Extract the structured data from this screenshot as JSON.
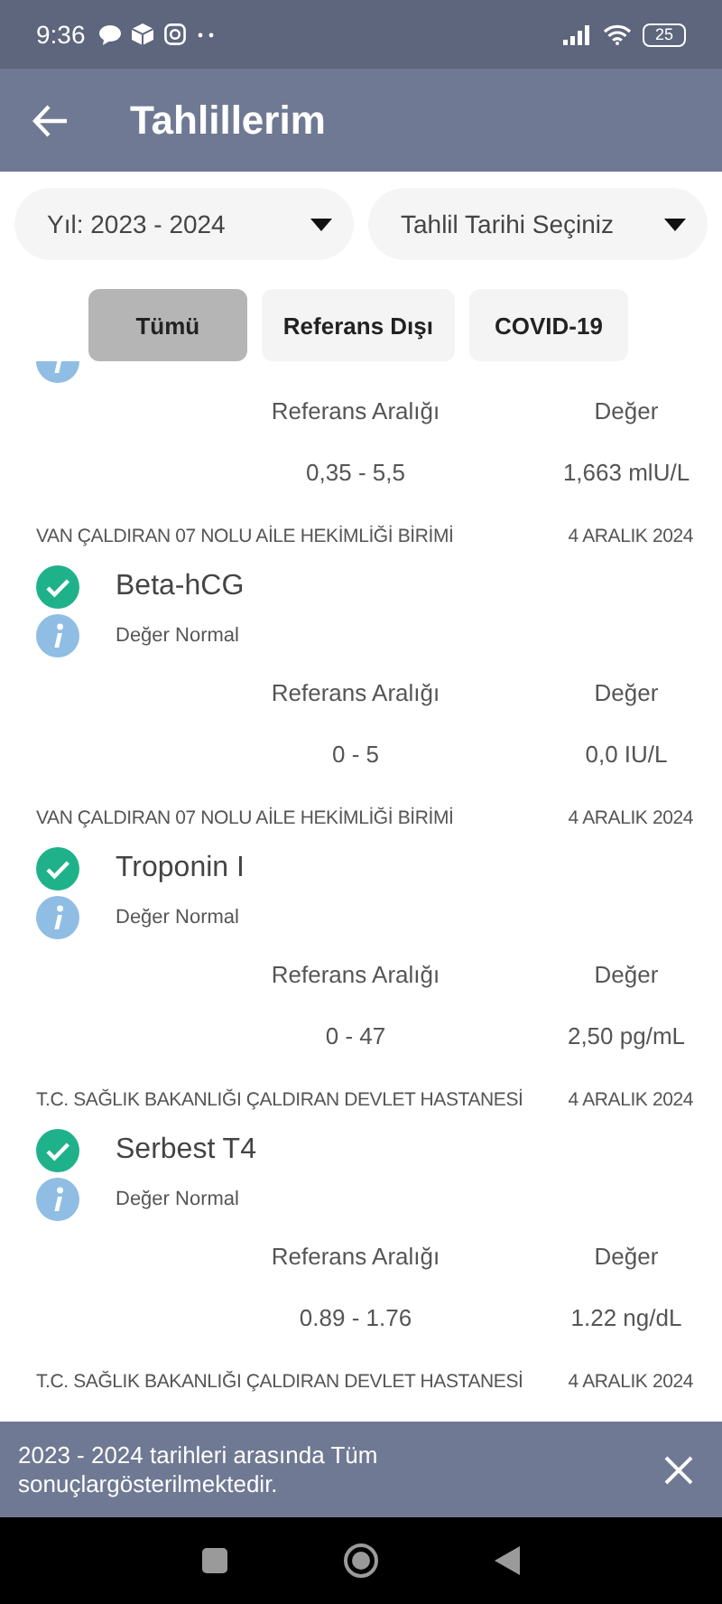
{
  "status_bar": {
    "time": "9:36",
    "battery": "25"
  },
  "app_bar": {
    "title": "Tahlillerim"
  },
  "filters": [
    {
      "label": "Yıl: 2023 - 2024"
    },
    {
      "label": "Tahlil Tarihi Seçiniz"
    }
  ],
  "tabs": [
    {
      "label": "Tümü",
      "selected": true
    },
    {
      "label": "Referans Dışı",
      "selected": false
    },
    {
      "label": "COVID-19",
      "selected": false
    }
  ],
  "results": [
    {
      "range_label": "Referans Aralığı",
      "value_label": "Değer",
      "range": "0,35 - 5,5",
      "value": "1,663 mlU/L"
    },
    {
      "hospital": "VAN ÇALDIRAN 07 NOLU AİLE HEKİMLİĞİ BİRİMİ",
      "date": "4 ARALIK 2024",
      "name": "Beta-hCG",
      "status": "Değer Normal",
      "range_label": "Referans Aralığı",
      "value_label": "Değer",
      "range": "0 - 5",
      "value": "0,0 IU/L"
    },
    {
      "hospital": "VAN ÇALDIRAN 07 NOLU AİLE HEKİMLİĞİ BİRİMİ",
      "date": "4 ARALIK 2024",
      "name": "Troponin I",
      "status": "Değer Normal",
      "range_label": "Referans Aralığı",
      "value_label": "Değer",
      "range": "0 - 47",
      "value": "2,50 pg/mL"
    },
    {
      "hospital": "T.C. SAĞLIK BAKANLIĞI ÇALDIRAN DEVLET HASTANESİ",
      "date": "4 ARALIK 2024",
      "name": "Serbest T4",
      "status": "Değer Normal",
      "range_label": "Referans Aralığı",
      "value_label": "Değer",
      "range": "0.89 - 1.76",
      "value": "1.22 ng/dL"
    },
    {
      "hospital": "T.C. SAĞLIK BAKANLIĞI ÇALDIRAN DEVLET HASTANESİ",
      "date": "4 ARALIK 2024"
    }
  ],
  "snackbar": {
    "message": "2023 - 2024 tarihleri arasında Tüm sonuçlargösterilmektedir."
  }
}
